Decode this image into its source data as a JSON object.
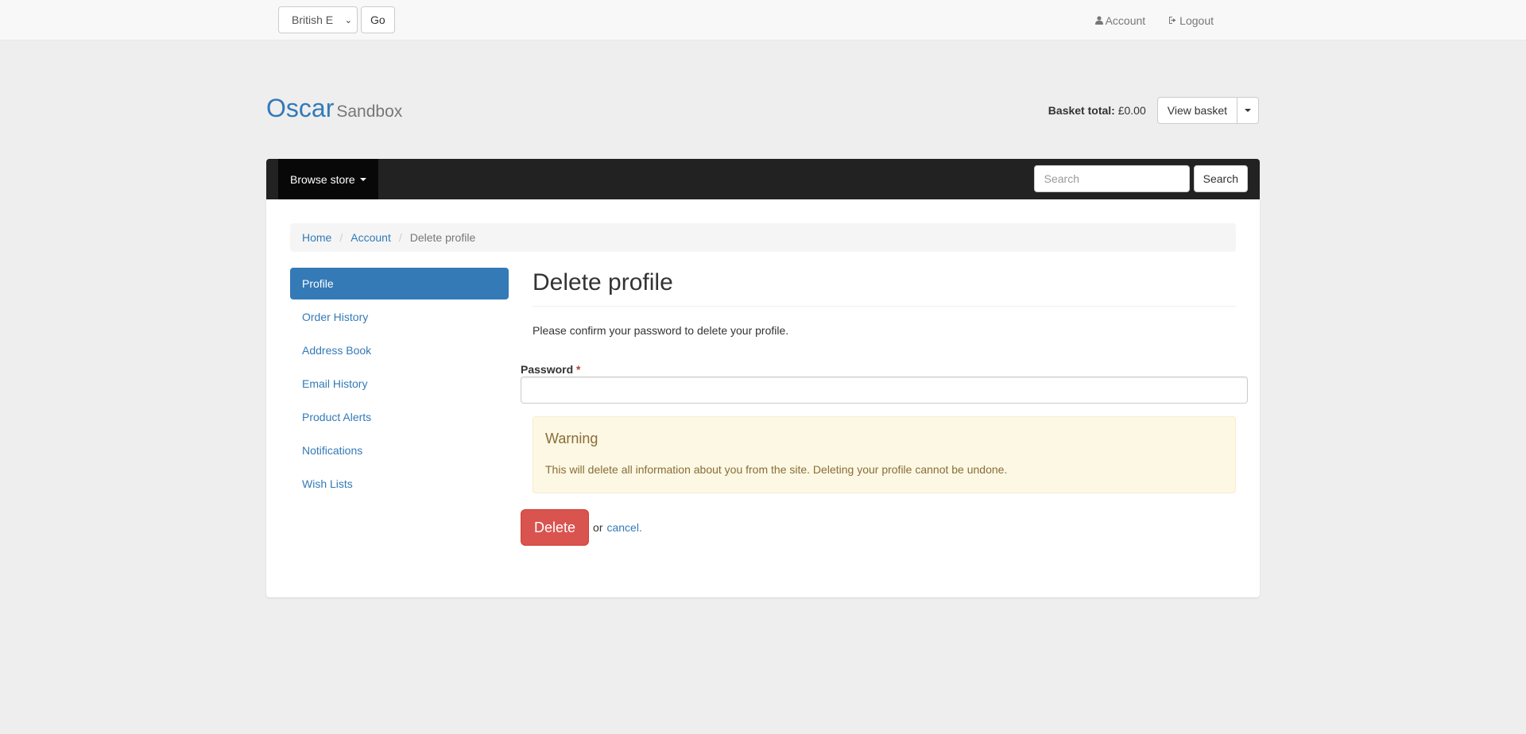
{
  "topbar": {
    "language_selected": "British E",
    "go_label": "Go",
    "account_label": "Account",
    "logout_label": "Logout"
  },
  "header": {
    "brand": "Oscar",
    "brand_sub": "Sandbox",
    "basket_total_label": "Basket total:",
    "basket_total_value": "£0.00",
    "view_basket_label": "View basket"
  },
  "navbar": {
    "browse_label": "Browse store",
    "search_placeholder": "Search",
    "search_button": "Search"
  },
  "breadcrumb": {
    "items": [
      "Home",
      "Account",
      "Delete profile"
    ]
  },
  "sidebar": {
    "items": [
      {
        "label": "Profile",
        "active": true
      },
      {
        "label": "Order History"
      },
      {
        "label": "Address Book"
      },
      {
        "label": "Email History"
      },
      {
        "label": "Product Alerts"
      },
      {
        "label": "Notifications"
      },
      {
        "label": "Wish Lists"
      }
    ]
  },
  "main": {
    "title": "Delete profile",
    "intro": "Please confirm your password to delete your profile.",
    "password_label": "Password",
    "required_mark": "*",
    "warning_title": "Warning",
    "warning_text": "This will delete all information about you from the site. Deleting your profile cannot be undone.",
    "delete_button": "Delete",
    "or_text": "or",
    "cancel_link": "cancel."
  },
  "colors": {
    "primary": "#337ab7",
    "danger": "#d9534f",
    "warning_bg": "#fcf8e3",
    "navbar_bg": "#222222"
  }
}
